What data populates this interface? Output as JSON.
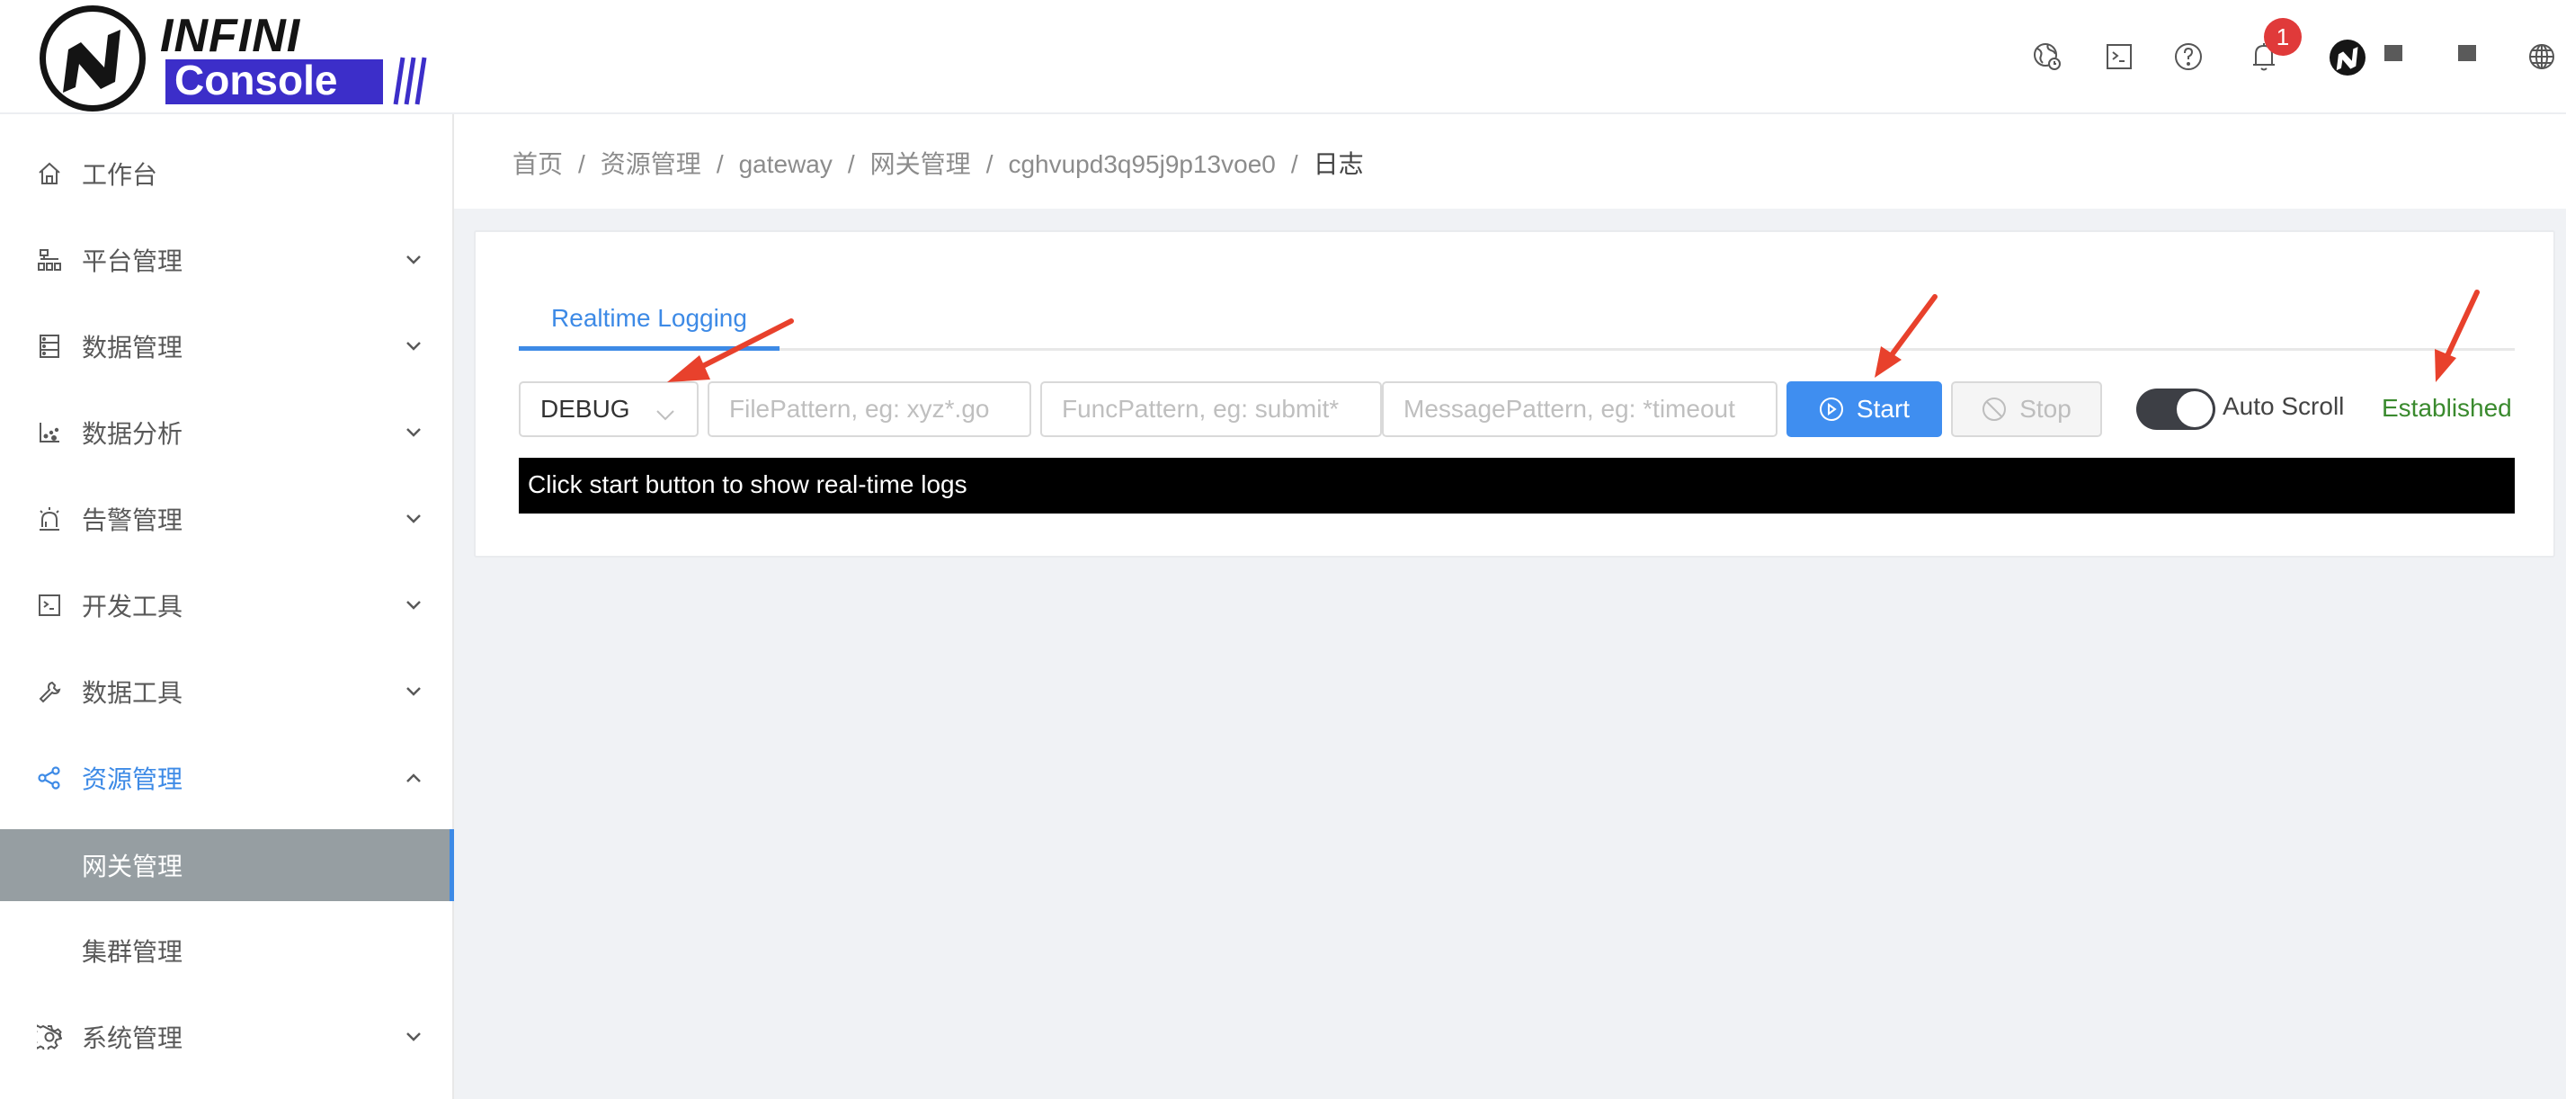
{
  "app": {
    "logo": {
      "line1": "INFINI",
      "line2": "Console"
    }
  },
  "header": {
    "icons": [
      "timezone-globe-icon",
      "terminal-icon",
      "help-icon",
      "notification-bell-icon",
      "language-globe-icon"
    ],
    "notification_count": "1",
    "username": "(obscured)"
  },
  "sidebar": {
    "items": [
      {
        "label": "工作台",
        "icon": "home-icon",
        "expandable": false
      },
      {
        "label": "平台管理",
        "icon": "cluster-icon",
        "expandable": true
      },
      {
        "label": "数据管理",
        "icon": "database-icon",
        "expandable": true
      },
      {
        "label": "数据分析",
        "icon": "scatter-chart-icon",
        "expandable": true
      },
      {
        "label": "告警管理",
        "icon": "alarm-icon",
        "expandable": true
      },
      {
        "label": "开发工具",
        "icon": "code-terminal-icon",
        "expandable": true
      },
      {
        "label": "数据工具",
        "icon": "wrench-icon",
        "expandable": true
      },
      {
        "label": "资源管理",
        "icon": "share-icon",
        "expandable": true,
        "expanded": true,
        "active": true,
        "children": [
          {
            "label": "网关管理",
            "selected": true
          },
          {
            "label": "集群管理",
            "selected": false
          }
        ]
      },
      {
        "label": "系统管理",
        "icon": "settings-icon",
        "expandable": true
      }
    ]
  },
  "breadcrumb": [
    "首页",
    "资源管理",
    "gateway",
    "网关管理",
    "cghvupd3q95j9p13voe0",
    "日志"
  ],
  "main": {
    "tabs": [
      {
        "label": "Realtime Logging",
        "active": true
      }
    ],
    "level_select": {
      "value": "DEBUG"
    },
    "file_pattern": {
      "value": "",
      "placeholder": "FilePattern, eg: xyz*.go"
    },
    "func_pattern": {
      "value": "",
      "placeholder": "FuncPattern, eg: submit*"
    },
    "message_pattern": {
      "value": "",
      "placeholder": "MessagePattern, eg: *timeout"
    },
    "start_label": "Start",
    "stop_label": "Stop",
    "auto_scroll": {
      "label": "Auto Scroll",
      "on": true
    },
    "status": {
      "text": "Established",
      "color": "#3a8a2e"
    },
    "log_message": "Click start button to show real-time logs"
  },
  "colors": {
    "accent": "#3d8ae6",
    "start_button": "#3f8ef0",
    "selected_menu_bg": "#969ea2",
    "badge": "#e03a3a",
    "annotation_arrow": "#e8412c",
    "content_bg": "#f0f2f5"
  }
}
